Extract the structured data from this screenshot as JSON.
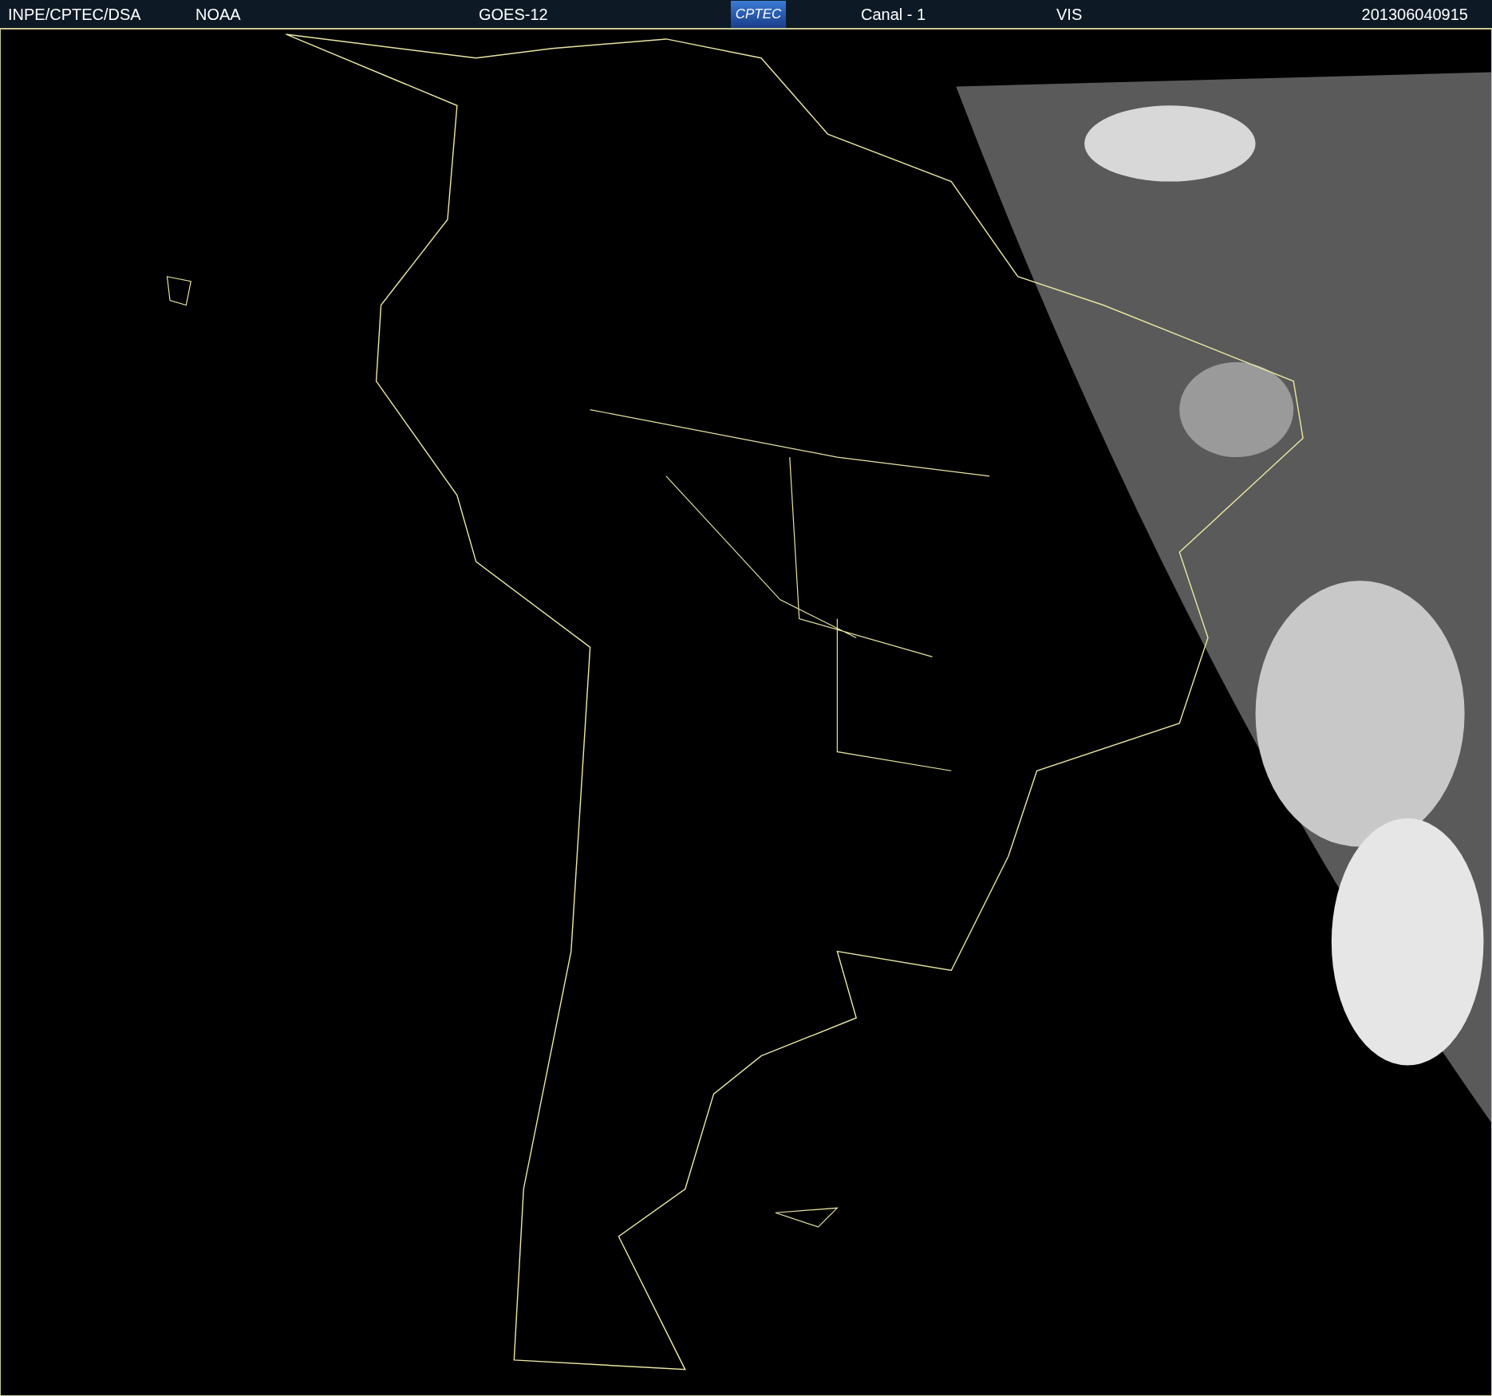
{
  "header": {
    "source": "INPE/CPTEC/DSA",
    "agency": "NOAA",
    "satellite": "GOES-12",
    "logo": "CPTEC",
    "channel": "Canal - 1",
    "band": "VIS",
    "timestamp": "201306040915"
  }
}
